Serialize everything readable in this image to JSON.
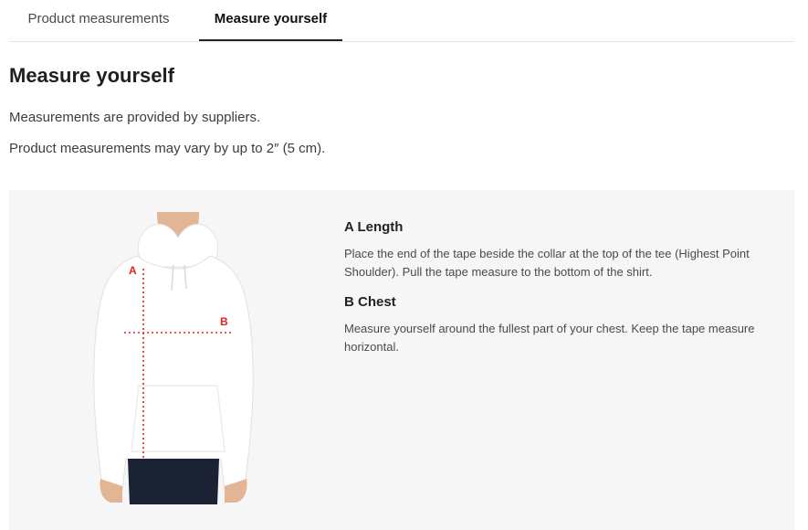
{
  "tabs": [
    {
      "label": "Product measurements",
      "active": false
    },
    {
      "label": "Measure yourself",
      "active": true
    }
  ],
  "title": "Measure yourself",
  "notes": [
    "Measurements are provided by suppliers.",
    "Product measurements may vary by up to 2″ (5 cm)."
  ],
  "figure": {
    "markers": [
      "A",
      "B"
    ],
    "marker_color": "#e02020"
  },
  "measurements": [
    {
      "heading": "A Length",
      "text": "Place the end of the tape beside the collar at the top of the tee (Highest Point Shoulder). Pull the tape measure to the bottom of the shirt."
    },
    {
      "heading": "B Chest",
      "text": "Measure yourself around the fullest part of your chest. Keep the tape measure horizontal."
    }
  ]
}
